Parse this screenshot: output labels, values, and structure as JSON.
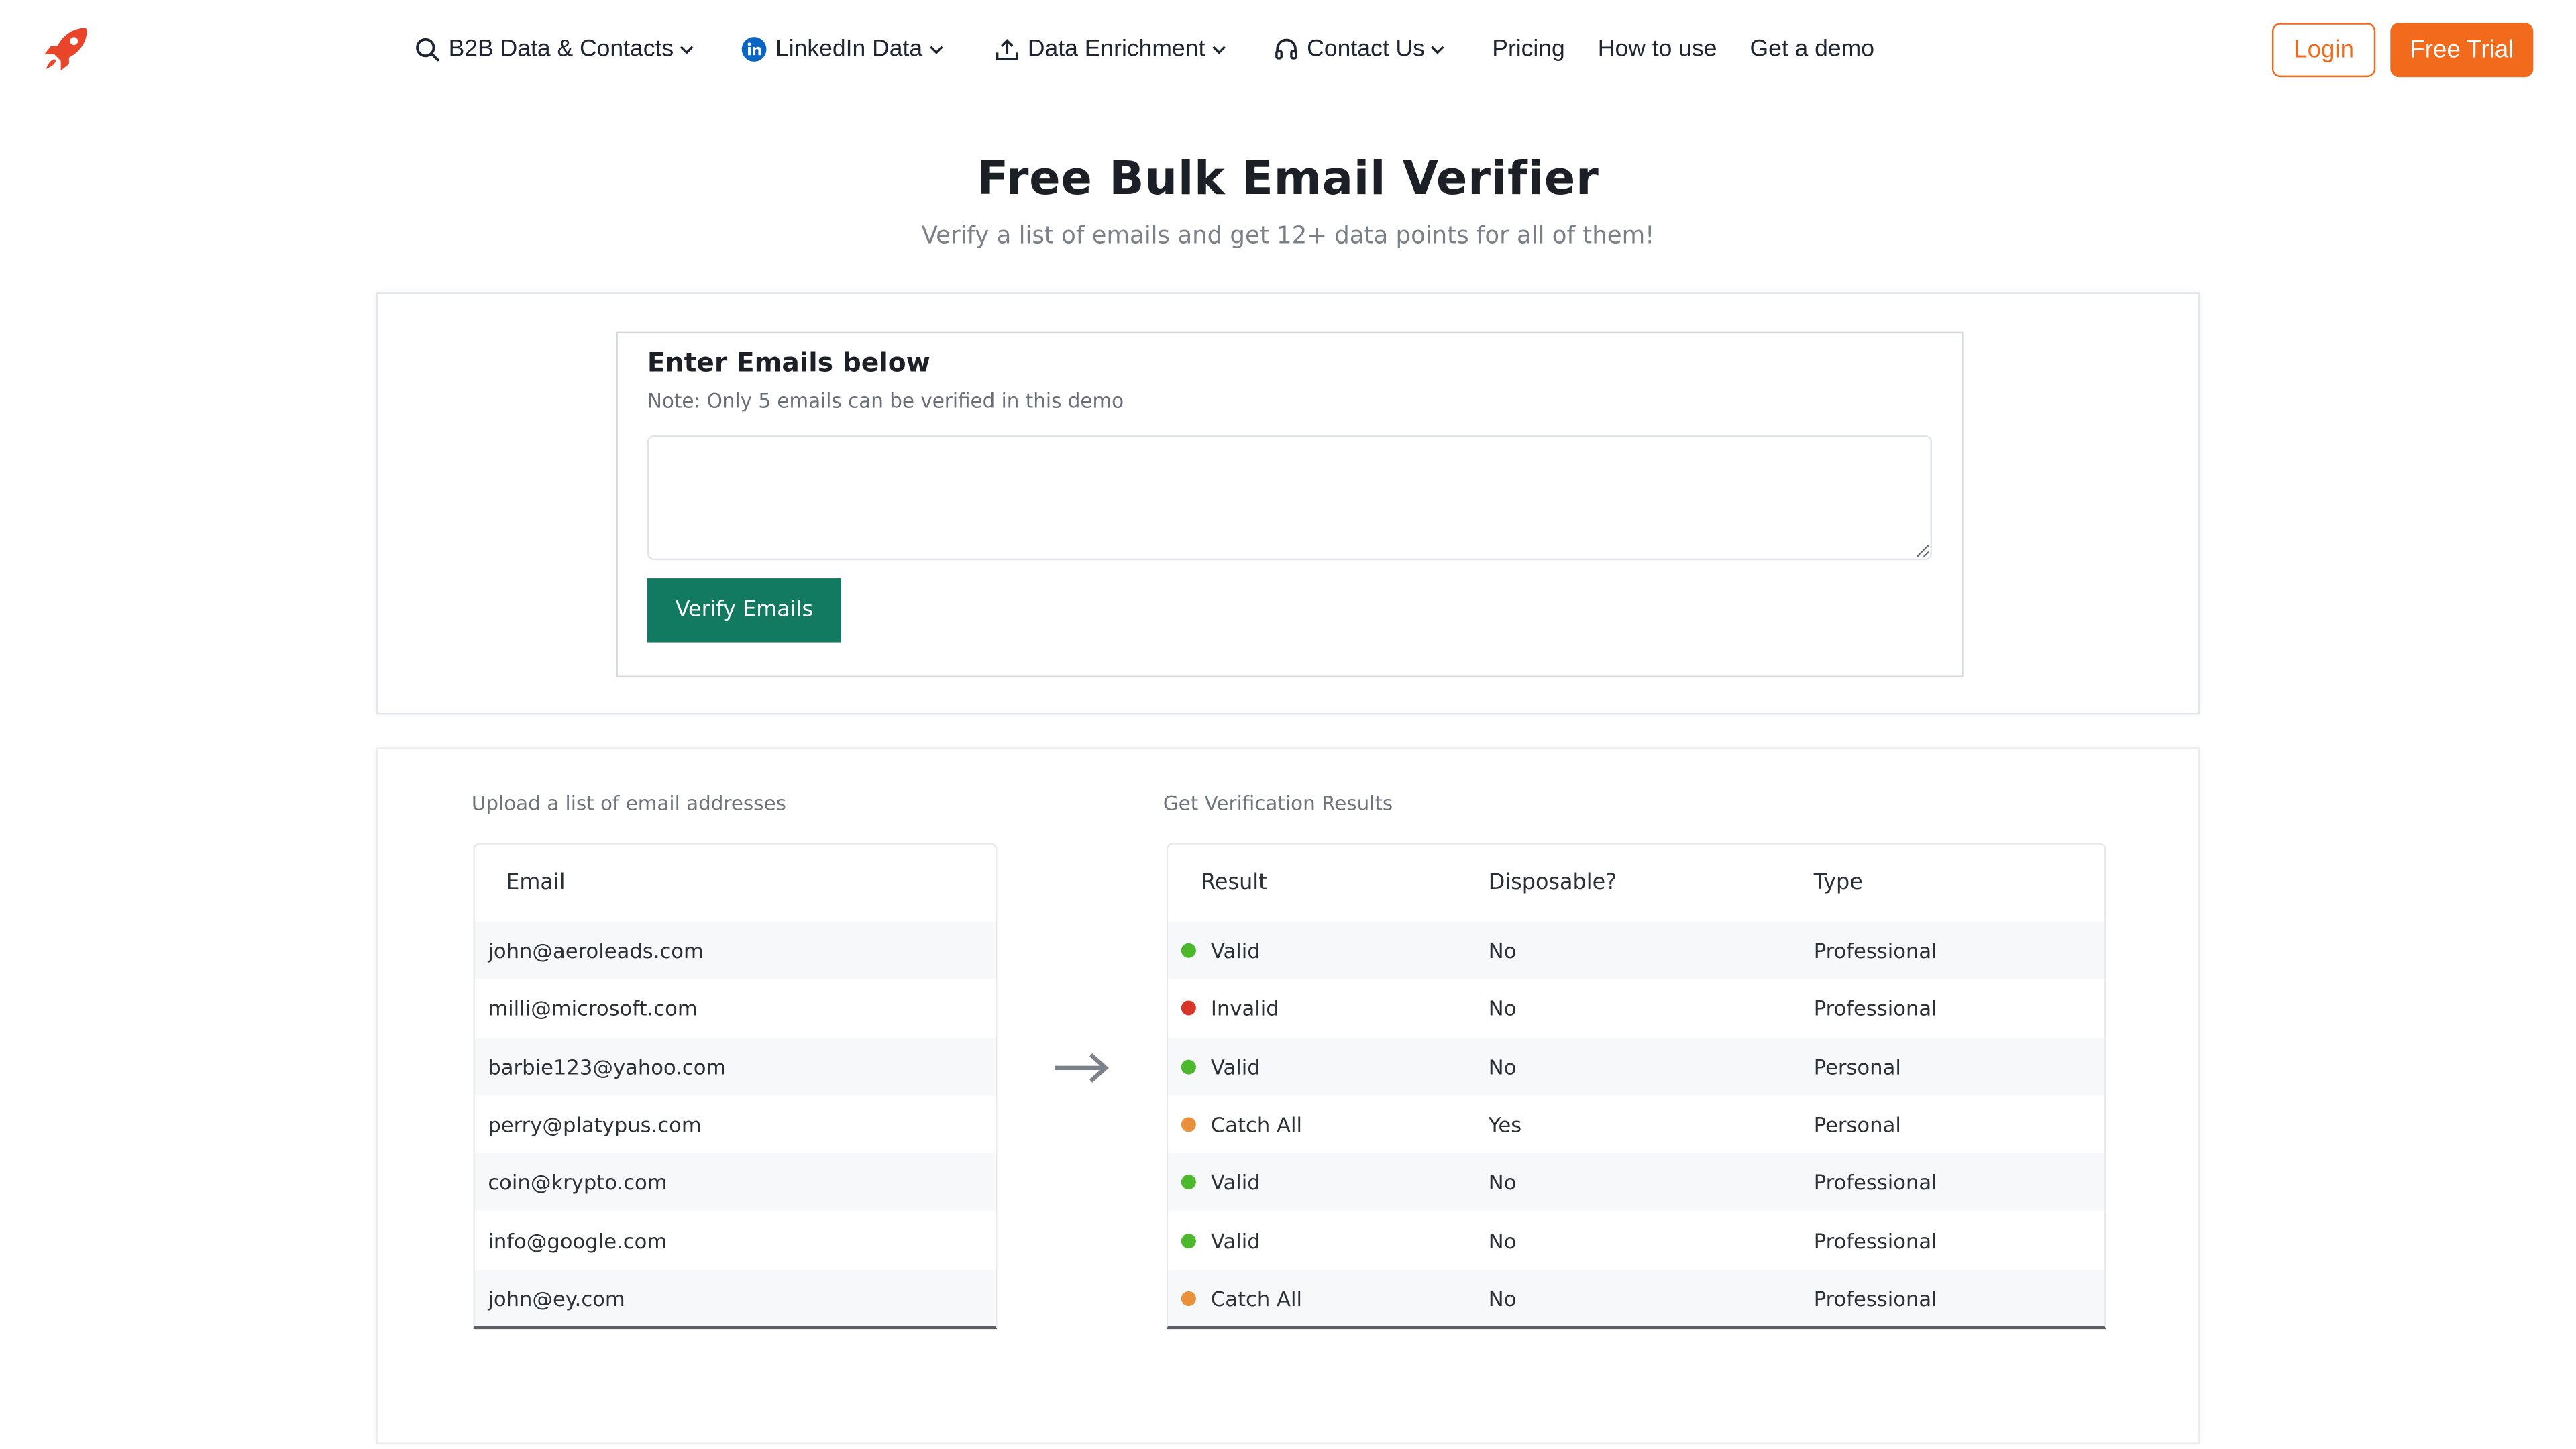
{
  "nav": {
    "menu": [
      {
        "label": "B2B Data & Contacts",
        "icon": "search-icon",
        "dropdown": true
      },
      {
        "label": "LinkedIn Data",
        "icon": "linkedin-icon",
        "dropdown": true
      },
      {
        "label": "Data Enrichment",
        "icon": "upload-icon",
        "dropdown": true
      },
      {
        "label": "Contact Us",
        "icon": "headset-icon",
        "dropdown": true
      },
      {
        "label": "Pricing",
        "dropdown": false
      },
      {
        "label": "How to use",
        "dropdown": false
      },
      {
        "label": "Get a demo",
        "dropdown": false
      }
    ],
    "login_label": "Login",
    "trial_label": "Free Trial"
  },
  "hero": {
    "title": "Free Bulk Email Verifier",
    "subtitle": "Verify a list of emails and get 12+ data points for all of them!"
  },
  "input_card": {
    "title": "Enter Emails below",
    "note": "Note: Only 5 emails can be verified in this demo",
    "textarea_value": "",
    "verify_label": "Verify Emails"
  },
  "demo": {
    "upload_caption": "Upload a list of email addresses",
    "results_caption": "Get Verification Results",
    "email_header": "Email",
    "result_headers": [
      "Result",
      "Disposable?",
      "Type"
    ],
    "emails": [
      "john@aeroleads.com",
      "milli@microsoft.com",
      "barbie123@yahoo.com",
      "perry@platypus.com",
      "coin@krypto.com",
      "info@google.com",
      "john@ey.com"
    ],
    "results": [
      {
        "result": "Valid",
        "disposable": "No",
        "type": "Professional",
        "status": "valid"
      },
      {
        "result": "Invalid",
        "disposable": "No",
        "type": "Professional",
        "status": "invalid"
      },
      {
        "result": "Valid",
        "disposable": "No",
        "type": "Personal",
        "status": "valid"
      },
      {
        "result": "Catch All",
        "disposable": "Yes",
        "type": "Personal",
        "status": "catchall"
      },
      {
        "result": "Valid",
        "disposable": "No",
        "type": "Professional",
        "status": "valid"
      },
      {
        "result": "Valid",
        "disposable": "No",
        "type": "Professional",
        "status": "valid"
      },
      {
        "result": "Catch All",
        "disposable": "No",
        "type": "Professional",
        "status": "catchall"
      }
    ]
  },
  "colors": {
    "brand_orange": "#f26a1b",
    "verify_green": "#127a61",
    "valid": "#4cb82c",
    "invalid": "#d9352b",
    "catchall": "#e8913a",
    "linkedin_blue": "#0a66c2"
  }
}
